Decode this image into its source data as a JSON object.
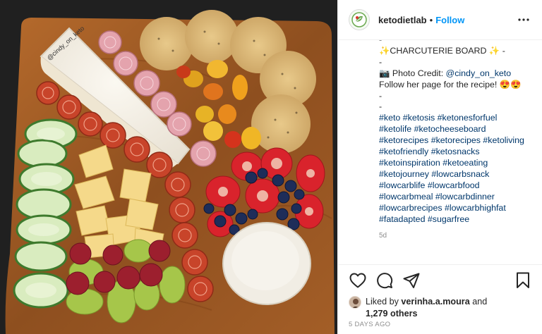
{
  "post": {
    "username": "ketodietlab",
    "follow_label": "Follow",
    "separator": "•",
    "more_icon": "more-options-icon",
    "photo_credit_handle": "@cindy_on_keto"
  },
  "caption": {
    "dash1": "-",
    "title": "✨CHARCUTERIE BOARD ✨ -",
    "dash2": "-",
    "credit_prefix": "📷 Photo Credit: ",
    "credit_handle": "@cindy_on_keto",
    "follow_text": "Follow her page for the recipe! 😍😍",
    "dash3": "-",
    "dash4": "-",
    "hashtag_lines": [
      "#keto #ketosis #ketonesforfuel",
      "#ketolife #ketocheeseboard",
      "#ketorecipes #ketorecipes #ketoliving",
      "#ketofriendly #ketosnacks",
      "#ketoinspiration #ketoeating",
      "#ketojourney #lowcarbsnack",
      "#lowcarblife #lowcarbfood",
      "#lowcarbmeal #lowcarbdinner",
      "#lowcarbrecipes #lowcarbhighfat",
      "#fatadapted #sugarfree"
    ],
    "time_ago": "5d"
  },
  "actions": {
    "like_icon": "heart-icon",
    "comment_icon": "comment-icon",
    "share_icon": "share-icon",
    "save_icon": "bookmark-icon"
  },
  "likes": {
    "prefix": "Liked by ",
    "user": "verinha.a.moura",
    "middle": " and",
    "count": "1,279 others"
  },
  "date": "5 DAYS AGO",
  "colors": {
    "link": "#00376b",
    "follow": "#0095f6",
    "text": "#262626",
    "muted": "#8e8e8e",
    "divider": "#efefef"
  }
}
